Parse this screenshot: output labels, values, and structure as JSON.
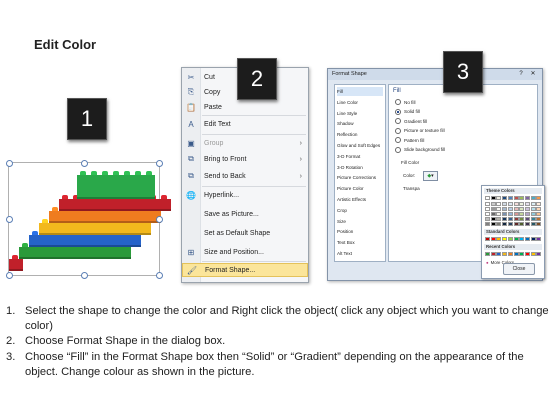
{
  "page": {
    "title": "Edit Color"
  },
  "badges": [
    "1",
    "2",
    "3"
  ],
  "lego": {
    "colors": [
      "#c0202a",
      "#2a9a3a",
      "#2563c9",
      "#f2b81d",
      "#ef7c1f",
      "#c0202a",
      "#2aa84a"
    ]
  },
  "context_menu": {
    "items": [
      {
        "label": "Cut",
        "icon": "scissors-icon",
        "glyph": "✂"
      },
      {
        "label": "Copy",
        "icon": "copy-icon",
        "glyph": "⎘"
      },
      {
        "label": "Paste",
        "icon": "paste-icon",
        "glyph": "📋"
      },
      {
        "label": "Edit Text",
        "icon": "edit-text-icon",
        "glyph": "A"
      },
      {
        "label": "Group",
        "icon": "group-icon",
        "glyph": "▣",
        "disabled": true,
        "submenu": true
      },
      {
        "label": "Bring to Front",
        "icon": "bring-front-icon",
        "glyph": "⧉",
        "submenu": true
      },
      {
        "label": "Send to Back",
        "icon": "send-back-icon",
        "glyph": "⧉",
        "submenu": true
      },
      {
        "label": "Hyperlink...",
        "icon": "hyperlink-icon",
        "glyph": "🌐"
      },
      {
        "label": "Save as Picture...",
        "icon": "",
        "glyph": ""
      },
      {
        "label": "Set as Default Shape",
        "icon": "",
        "glyph": ""
      },
      {
        "label": "Size and Position...",
        "icon": "size-position-icon",
        "glyph": "⊞"
      },
      {
        "label": "Format Shape...",
        "icon": "format-shape-icon",
        "glyph": "🖌"
      }
    ]
  },
  "dialog": {
    "title": "Format Shape",
    "categories": [
      "Fill",
      "Line Color",
      "Line Style",
      "Shadow",
      "Reflection",
      "Glow and Soft Edges",
      "3-D Format",
      "3-D Rotation",
      "Picture Corrections",
      "Picture Color",
      "Artistic Effects",
      "Crop",
      "Size",
      "Position",
      "Text Box",
      "Alt Text"
    ],
    "panel_heading": "Fill",
    "fill_options": [
      "No fill",
      "Solid fill",
      "Gradient fill",
      "Picture or texture fill",
      "Pattern fill",
      "Slide background fill"
    ],
    "fill_color_label": "Fill Color",
    "color_label": "Color:",
    "transparency_label": "Transpa",
    "theme_colors_label": "Theme Colors",
    "standard_colors_label": "Standard Colors",
    "recent_colors_label": "Recent Colors",
    "more_colors_label": "More Colors...",
    "close_label": "Close",
    "theme_top": [
      "#ffffff",
      "#000000",
      "#eeece1",
      "#1f497d",
      "#4f81bd",
      "#c0504d",
      "#9bbb59",
      "#8064a2",
      "#4bacc6",
      "#f79646"
    ],
    "standard": [
      "#c00000",
      "#ff0000",
      "#ffc000",
      "#ffff00",
      "#92d050",
      "#00b050",
      "#00b0f0",
      "#0070c0",
      "#002060",
      "#7030a0"
    ],
    "recent": [
      "#2a9a3a",
      "#c0202a",
      "#2563c9",
      "#f2b81d",
      "#ef7c1f",
      "#0070c0",
      "#00b050",
      "#ff0000",
      "#ffc000",
      "#7030a0"
    ]
  },
  "steps": [
    {
      "num": "1.",
      "text": "Select the shape to change the color and Right click the object( click any object which you want to change color)"
    },
    {
      "num": "2.",
      "text": "Choose Format Shape in the dialog box."
    },
    {
      "num": "3.",
      "text": "Choose “Fill” in the Format Shape box then “Solid” or “Gradient” depending on the appearance of the object. Change colour as shown in the picture."
    }
  ]
}
